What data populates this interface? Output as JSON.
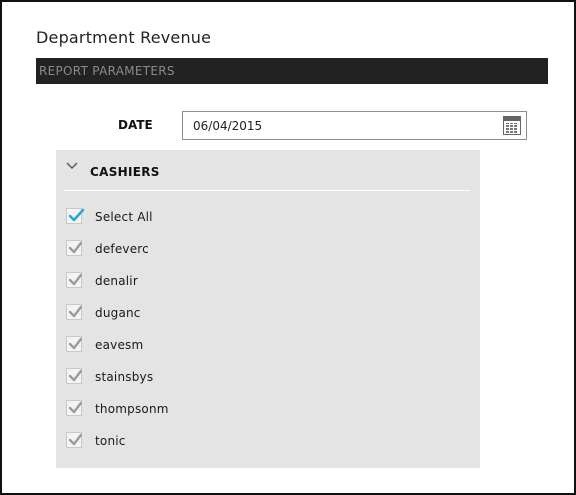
{
  "page": {
    "title": "Department Revenue",
    "section_header": "REPORT PARAMETERS"
  },
  "date_param": {
    "label": "DATE",
    "value": "06/04/2015",
    "icon": "calendar-icon"
  },
  "cashiers": {
    "title": "CASHIERS",
    "expanded": true,
    "icon": "chevron-down-icon",
    "select_all": {
      "label": "Select All",
      "checked": true
    },
    "items": [
      {
        "label": "defeverc",
        "checked": true
      },
      {
        "label": "denalir",
        "checked": true
      },
      {
        "label": "duganc",
        "checked": true
      },
      {
        "label": "eavesm",
        "checked": true
      },
      {
        "label": "stainsbys",
        "checked": true
      },
      {
        "label": "thompsonm",
        "checked": true
      },
      {
        "label": "tonic",
        "checked": true
      }
    ]
  },
  "colors": {
    "section_bar": "#222222",
    "panel_bg": "#e4e4e4",
    "select_all_check": "#29a8d8",
    "item_check": "#9a9a9a"
  }
}
